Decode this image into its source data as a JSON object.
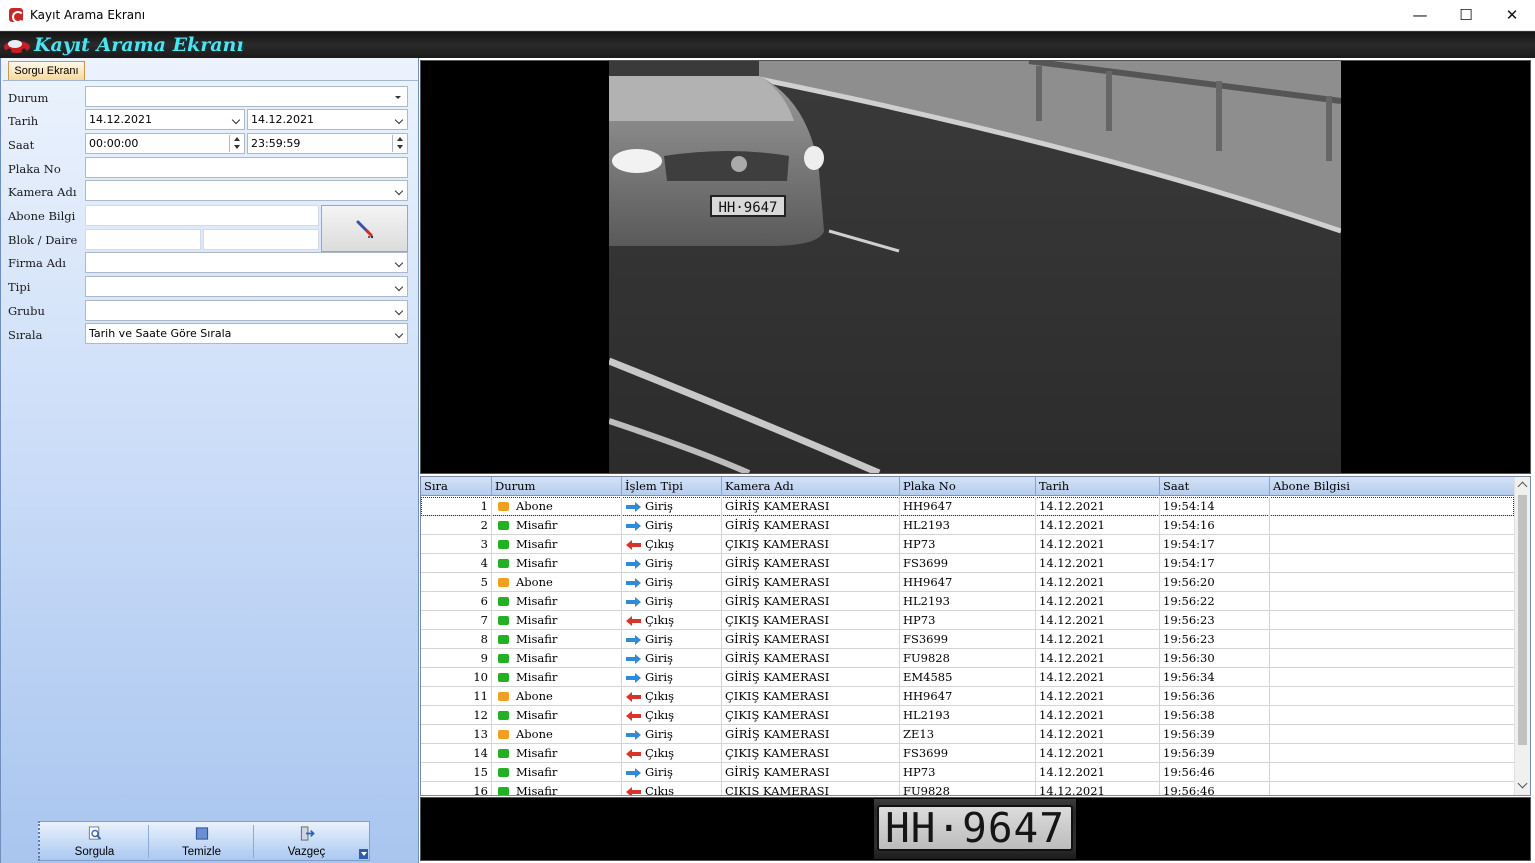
{
  "window": {
    "title": "Kayıt Arama Ekranı"
  },
  "banner": {
    "title": "Kayıt Arama Ekranı"
  },
  "left": {
    "tab": "Sorgu Ekranı",
    "labels": {
      "durum": "Durum",
      "tarih": "Tarih",
      "saat": "Saat",
      "plaka": "Plaka No",
      "kamera": "Kamera Adı",
      "abone": "Abone Bilgi",
      "blok": "Blok / Daire",
      "firma": "Firma Adı",
      "tipi": "Tipi",
      "grubu": "Grubu",
      "sirala": "Sıralа"
    },
    "values": {
      "durum": "",
      "tarih_from": "14.12.2021",
      "tarih_to": "14.12.2021",
      "saat_from": "00:00:00",
      "saat_to": "23:59:59",
      "plaka": "",
      "kamera": "",
      "abone": "",
      "blok": "",
      "daire": "",
      "firma": "",
      "tipi": "",
      "grubu": "",
      "sirala": "Tarih ve Saate Göre Sırala"
    }
  },
  "toolbar": {
    "sorgula": "Sorgula",
    "temizle": "Temizle",
    "vazgec": "Vazgeç"
  },
  "grid": {
    "columns": [
      "Sıra",
      "Durum",
      "İşlem Tipi",
      "Kamera Adı",
      "Plaka No",
      "Tarih",
      "Saat",
      "Abone Bilgisi"
    ],
    "rows": [
      {
        "sira": "1",
        "durum": "Abone",
        "islem": "Giriş",
        "kamera": "GİRİŞ KAMERASI",
        "plaka": "HH9647",
        "tarih": "14.12.2021",
        "saat": "19:54:14",
        "abone": ""
      },
      {
        "sira": "2",
        "durum": "Misafir",
        "islem": "Giriş",
        "kamera": "GİRİŞ KAMERASI",
        "plaka": "HL2193",
        "tarih": "14.12.2021",
        "saat": "19:54:16",
        "abone": ""
      },
      {
        "sira": "3",
        "durum": "Misafir",
        "islem": "Çıkış",
        "kamera": "ÇIKIŞ KAMERASI",
        "plaka": "HP73",
        "tarih": "14.12.2021",
        "saat": "19:54:17",
        "abone": ""
      },
      {
        "sira": "4",
        "durum": "Misafir",
        "islem": "Giriş",
        "kamera": "GİRİŞ KAMERASI",
        "plaka": "FS3699",
        "tarih": "14.12.2021",
        "saat": "19:54:17",
        "abone": ""
      },
      {
        "sira": "5",
        "durum": "Abone",
        "islem": "Giriş",
        "kamera": "GİRİŞ KAMERASI",
        "plaka": "HH9647",
        "tarih": "14.12.2021",
        "saat": "19:56:20",
        "abone": ""
      },
      {
        "sira": "6",
        "durum": "Misafir",
        "islem": "Giriş",
        "kamera": "GİRİŞ KAMERASI",
        "plaka": "HL2193",
        "tarih": "14.12.2021",
        "saat": "19:56:22",
        "abone": ""
      },
      {
        "sira": "7",
        "durum": "Misafir",
        "islem": "Çıkış",
        "kamera": "ÇIKIŞ KAMERASI",
        "plaka": "HP73",
        "tarih": "14.12.2021",
        "saat": "19:56:23",
        "abone": ""
      },
      {
        "sira": "8",
        "durum": "Misafir",
        "islem": "Giriş",
        "kamera": "GİRİŞ KAMERASI",
        "plaka": "FS3699",
        "tarih": "14.12.2021",
        "saat": "19:56:23",
        "abone": ""
      },
      {
        "sira": "9",
        "durum": "Misafir",
        "islem": "Giriş",
        "kamera": "GİRİŞ KAMERASI",
        "plaka": "FU9828",
        "tarih": "14.12.2021",
        "saat": "19:56:30",
        "abone": ""
      },
      {
        "sira": "10",
        "durum": "Misafir",
        "islem": "Giriş",
        "kamera": "GİRİŞ KAMERASI",
        "plaka": "EM4585",
        "tarih": "14.12.2021",
        "saat": "19:56:34",
        "abone": ""
      },
      {
        "sira": "11",
        "durum": "Abone",
        "islem": "Çıkış",
        "kamera": "ÇIKIŞ KAMERASI",
        "plaka": "HH9647",
        "tarih": "14.12.2021",
        "saat": "19:56:36",
        "abone": ""
      },
      {
        "sira": "12",
        "durum": "Misafir",
        "islem": "Çıkış",
        "kamera": "ÇIKIŞ KAMERASI",
        "plaka": "HL2193",
        "tarih": "14.12.2021",
        "saat": "19:56:38",
        "abone": ""
      },
      {
        "sira": "13",
        "durum": "Abone",
        "islem": "Giriş",
        "kamera": "GİRİŞ KAMERASI",
        "plaka": "ZE13",
        "tarih": "14.12.2021",
        "saat": "19:56:39",
        "abone": ""
      },
      {
        "sira": "14",
        "durum": "Misafir",
        "islem": "Çıkış",
        "kamera": "ÇIKIŞ KAMERASI",
        "plaka": "FS3699",
        "tarih": "14.12.2021",
        "saat": "19:56:39",
        "abone": ""
      },
      {
        "sira": "15",
        "durum": "Misafir",
        "islem": "Giriş",
        "kamera": "GİRİŞ KAMERASI",
        "plaka": "HP73",
        "tarih": "14.12.2021",
        "saat": "19:56:46",
        "abone": ""
      },
      {
        "sira": "16",
        "durum": "Misafir",
        "islem": "Çıkış",
        "kamera": "ÇIKIŞ KAMERASI",
        "plaka": "FU9828",
        "tarih": "14.12.2021",
        "saat": "19:56:46",
        "abone": ""
      }
    ]
  },
  "viewer": {
    "car_plate": "HH·9647"
  },
  "plate_strip": {
    "text": "HH·9647"
  },
  "colors": {
    "abone": "#f0a020",
    "misafir": "#23b023",
    "giris_arrow": "#2f8ad8",
    "cikis_arrow": "#d8342a",
    "banner_text": "#4fe3f0"
  },
  "icons": {
    "app": "app-logo-icon",
    "abone_btn": "pen-icon",
    "sorgula": "magnifier-page-icon",
    "temizle": "square-icon",
    "vazgec": "exit-door-icon"
  }
}
